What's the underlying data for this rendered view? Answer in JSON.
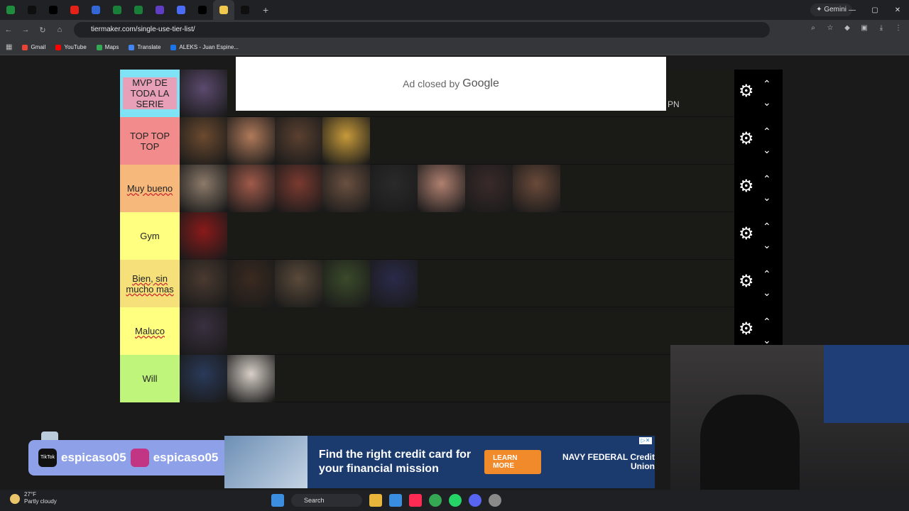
{
  "browser": {
    "url": "tiermaker.com/single-use-tier-list/",
    "gemini_label": "Gemini",
    "tab_colors": [
      "#1e8e3e",
      "#0f0f0f",
      "#000000",
      "#e62117",
      "#3367d6",
      "#188038",
      "#188038",
      "#5f3dc4",
      "#4a6cf7",
      "#000000",
      "#f2c94c",
      "#0f0f0f"
    ],
    "bookmarks": [
      {
        "label": "Gmail",
        "color": "#ea4335"
      },
      {
        "label": "YouTube",
        "color": "#ff0000"
      },
      {
        "label": "Maps",
        "color": "#34a853"
      },
      {
        "label": "Translate",
        "color": "#4285f4"
      },
      {
        "label": "ALEKS - Juan Espine...",
        "color": "#1a73e8"
      }
    ]
  },
  "ad_closed": {
    "text": "Ad closed by",
    "brand": "Google"
  },
  "partial_text": "PN",
  "tiers": [
    {
      "label": "MVP DE TODA LA SERIE",
      "color": "#7fe3f5",
      "items": [
        "#5b4a6e"
      ]
    },
    {
      "label": "TOP TOP TOP",
      "color": "#f28b8b",
      "items": [
        "#6b4a2f",
        "#b07a5a",
        "#5a4030",
        "#c79a3a"
      ]
    },
    {
      "label": "Muy bueno",
      "color": "#f7b87c",
      "items": [
        "#8c7a6a",
        "#a05a4a",
        "#7a3a30",
        "#6a5040",
        "#2a2a2a",
        "#b08070",
        "#3a2a2a",
        "#6a4a3a"
      ]
    },
    {
      "label": "Gym",
      "color": "#ffff80",
      "items": [
        "#8a1a1a"
      ]
    },
    {
      "label": "Bien, sin mucho mas",
      "color": "#f5e07a",
      "items": [
        "#4a3a30",
        "#3a2a20",
        "#5a4a3a",
        "#3a4a2a",
        "#2a2a4a"
      ]
    },
    {
      "label": "Maluco",
      "color": "#ffff80",
      "items": [
        "#3a3040"
      ]
    },
    {
      "label": "Will",
      "color": "#bff57a",
      "items": [
        "#2a3a5a",
        "#d8d0c8"
      ]
    }
  ],
  "social": {
    "tiktok": "espicaso05",
    "instagram": "espicaso05",
    "tiktok_icon_label": "TikTok"
  },
  "ad_banner": {
    "headline": "Find the right credit card for your financial mission",
    "cta": "LEARN MORE",
    "brand": "NAVY FEDERAL Credit Union"
  },
  "taskbar": {
    "temp": "27°F",
    "weather": "Partly cloudy",
    "search_placeholder": "Search"
  }
}
